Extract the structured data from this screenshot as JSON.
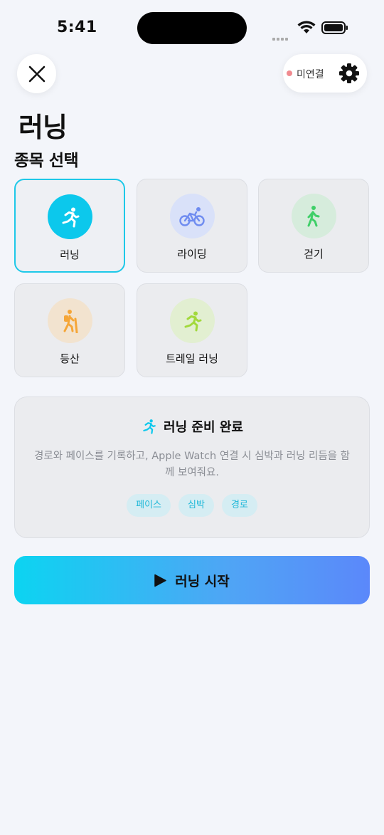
{
  "status_bar": {
    "time": "5:41"
  },
  "header": {
    "connection_status": "미연결",
    "connection_dot_color": "#f08a8f",
    "close_icon": "close-icon",
    "settings_icon": "gear-icon"
  },
  "page_title": "러닝",
  "section_title": "종목 선택",
  "sports": [
    {
      "label": "러닝",
      "icon": "running-icon",
      "selected": true,
      "color": "#0cc8ec"
    },
    {
      "label": "라이딩",
      "icon": "bicycle-icon",
      "selected": false,
      "color": "#6f8cf0"
    },
    {
      "label": "걷기",
      "icon": "walking-icon",
      "selected": false,
      "color": "#3fcf68"
    },
    {
      "label": "등산",
      "icon": "hiking-icon",
      "selected": false,
      "color": "#f5a638"
    },
    {
      "label": "트레일 러닝",
      "icon": "trail-running-icon",
      "selected": false,
      "color": "#a2d93c"
    }
  ],
  "info": {
    "title": "러닝 준비 완료",
    "description": "경로와 페이스를 기록하고, Apple Watch 연결 시 심박과 러닝 리듬을 함께 보여줘요.",
    "tags": [
      "페이스",
      "심박",
      "경로"
    ]
  },
  "start_button": {
    "label": "러닝 시작"
  },
  "colors": {
    "accent": "#1ec8e8",
    "tag_text": "#1fb8d8",
    "background": "#f3f5fa"
  }
}
